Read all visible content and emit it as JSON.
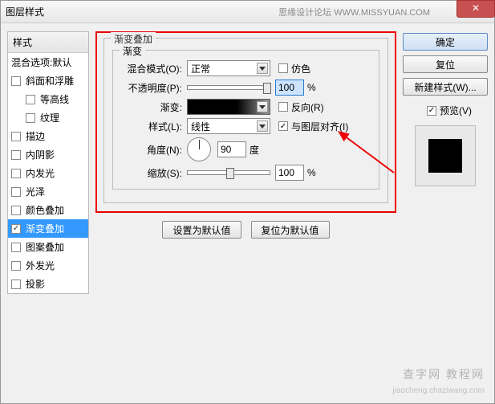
{
  "window": {
    "title": "图层样式",
    "subtitle": "思缘设计论坛  WWW.MISSYUAN.COM"
  },
  "left": {
    "header": "样式",
    "blending": "混合选项:默认",
    "items": [
      {
        "label": "斜面和浮雕",
        "checked": false
      },
      {
        "label": "等高线",
        "checked": false,
        "sub": true
      },
      {
        "label": "纹理",
        "checked": false,
        "sub": true
      },
      {
        "label": "描边",
        "checked": false
      },
      {
        "label": "内阴影",
        "checked": false
      },
      {
        "label": "内发光",
        "checked": false
      },
      {
        "label": "光泽",
        "checked": false
      },
      {
        "label": "颜色叠加",
        "checked": false
      },
      {
        "label": "渐变叠加",
        "checked": true,
        "selected": true
      },
      {
        "label": "图案叠加",
        "checked": false
      },
      {
        "label": "外发光",
        "checked": false
      },
      {
        "label": "投影",
        "checked": false
      }
    ]
  },
  "main": {
    "group_title": "渐变叠加",
    "inner_title": "渐变",
    "blend_label": "混合模式(O):",
    "blend_value": "正常",
    "dither_label": "仿色",
    "opacity_label": "不透明度(P):",
    "opacity_value": "100",
    "percent": "%",
    "gradient_label": "渐变:",
    "reverse_label": "反向(R)",
    "style_label": "样式(L):",
    "style_value": "线性",
    "align_label": "与图层对齐(I)",
    "angle_label": "角度(N):",
    "angle_value": "90",
    "angle_unit": "度",
    "scale_label": "缩放(S):",
    "scale_value": "100",
    "btn_default": "设置为默认值",
    "btn_reset": "复位为默认值"
  },
  "right": {
    "ok": "确定",
    "cancel": "复位",
    "newstyle": "新建样式(W)...",
    "preview_label": "预览(V)"
  },
  "wm": {
    "a": "查字网 教程网",
    "b": "jiaocheng.chaziwang.com"
  }
}
